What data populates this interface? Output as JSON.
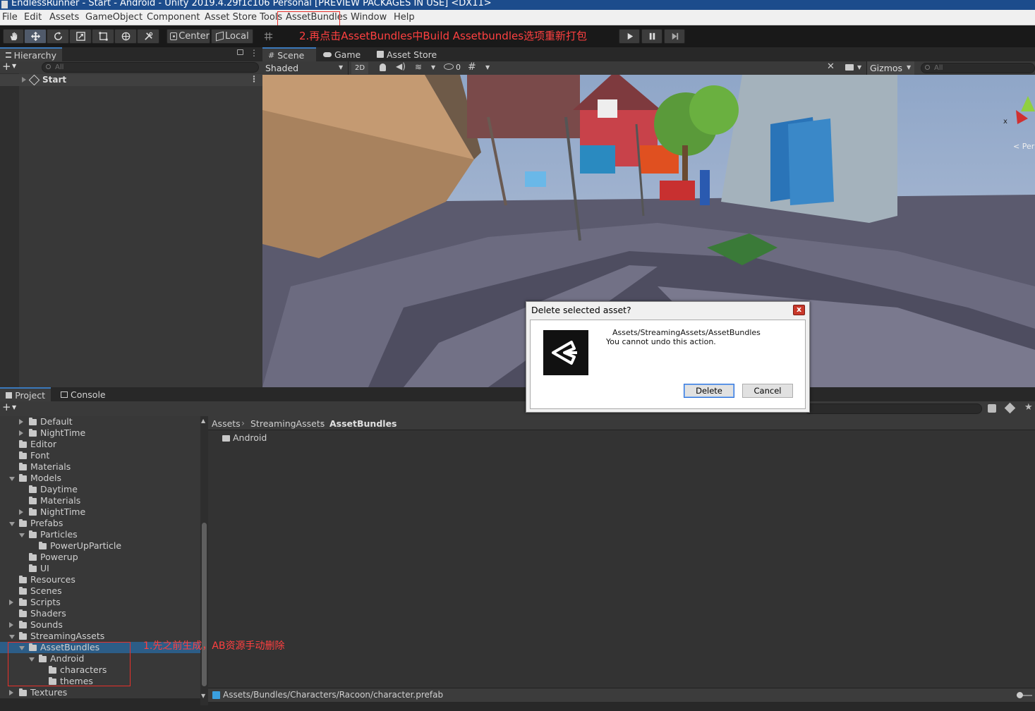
{
  "window": {
    "title": "EndlessRunner - Start - Android - Unity 2019.4.29f1c106 Personal [PREVIEW PACKAGES IN USE] <DX11>"
  },
  "menu": [
    "File",
    "Edit",
    "Assets",
    "GameObject",
    "Component",
    "Asset Store Tools",
    "AssetBundles",
    "Window",
    "Help"
  ],
  "toolbar": {
    "pivot_label": "Center",
    "space_label": "Local",
    "annotation": "2.再点击AssetBundles中Build Assetbundles选项重新打包"
  },
  "hierarchy": {
    "tab": "Hierarchy",
    "search_placeholder": "All",
    "root_item": "Start"
  },
  "scene": {
    "tabs": [
      "Scene",
      "Game",
      "Asset Store"
    ],
    "shading_mode": "Shaded",
    "mode_2d": "2D",
    "hidden_count": "0",
    "gizmos": "Gizmos",
    "search_placeholder": "All",
    "gizmo_axis": "x",
    "projection": "Per"
  },
  "project": {
    "tabs": [
      "Project",
      "Console"
    ],
    "tree": [
      {
        "label": "Default",
        "depth": 2,
        "arrow": "closed"
      },
      {
        "label": "NightTime",
        "depth": 2,
        "arrow": "closed"
      },
      {
        "label": "Editor",
        "depth": 1,
        "arrow": "none"
      },
      {
        "label": "Font",
        "depth": 1,
        "arrow": "none"
      },
      {
        "label": "Materials",
        "depth": 1,
        "arrow": "none"
      },
      {
        "label": "Models",
        "depth": 1,
        "arrow": "open"
      },
      {
        "label": "Daytime",
        "depth": 2,
        "arrow": "none"
      },
      {
        "label": "Materials",
        "depth": 2,
        "arrow": "none"
      },
      {
        "label": "NightTime",
        "depth": 2,
        "arrow": "closed"
      },
      {
        "label": "Prefabs",
        "depth": 1,
        "arrow": "open"
      },
      {
        "label": "Particles",
        "depth": 2,
        "arrow": "open"
      },
      {
        "label": "PowerUpParticle",
        "depth": 3,
        "arrow": "none"
      },
      {
        "label": "Powerup",
        "depth": 2,
        "arrow": "none"
      },
      {
        "label": "UI",
        "depth": 2,
        "arrow": "none"
      },
      {
        "label": "Resources",
        "depth": 1,
        "arrow": "none"
      },
      {
        "label": "Scenes",
        "depth": 1,
        "arrow": "none"
      },
      {
        "label": "Scripts",
        "depth": 1,
        "arrow": "closed"
      },
      {
        "label": "Shaders",
        "depth": 1,
        "arrow": "none"
      },
      {
        "label": "Sounds",
        "depth": 1,
        "arrow": "closed"
      },
      {
        "label": "StreamingAssets",
        "depth": 1,
        "arrow": "open"
      },
      {
        "label": "AssetBundles",
        "depth": 2,
        "arrow": "open",
        "selected": true
      },
      {
        "label": "Android",
        "depth": 3,
        "arrow": "open"
      },
      {
        "label": "characters",
        "depth": 4,
        "arrow": "none"
      },
      {
        "label": "themes",
        "depth": 4,
        "arrow": "none"
      },
      {
        "label": "Textures",
        "depth": 1,
        "arrow": "closed"
      }
    ],
    "breadcrumb": [
      "Assets",
      "StreamingAssets",
      "AssetBundles"
    ],
    "content_items": [
      "Android"
    ],
    "status_path": "Assets/Bundles/Characters/Racoon/character.prefab",
    "annotation": "1.先之前生成，AB资源手动删除"
  },
  "dialog": {
    "title": "Delete selected asset?",
    "path": "Assets/StreamingAssets/AssetBundles",
    "warning": "You cannot undo this action.",
    "delete_label": "Delete",
    "cancel_label": "Cancel",
    "close_label": "x"
  },
  "colors": {
    "accent": "#3a79bb",
    "selection": "#2c5d87",
    "annotation": "#ff4040"
  }
}
